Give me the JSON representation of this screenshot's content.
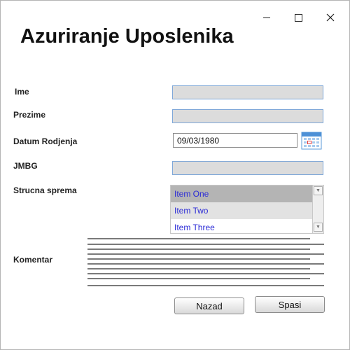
{
  "window": {
    "title": "Azuriranje Uposlenika",
    "controls": [
      "minimize-icon",
      "maximize-icon",
      "close-icon"
    ]
  },
  "form": {
    "ime_label": "Ime",
    "prezime_label": "Prezime",
    "datum_label": "Datum Rodjenja",
    "datum_value": "09/03/1980",
    "jmbg_label": "JMBG",
    "strucna_label": "Strucna sprema",
    "strucna_items": [
      "Item One",
      "Item Two",
      "Item Three"
    ],
    "selected_item": "Item One",
    "komentar_label": "Komentar"
  },
  "buttons": {
    "nazad": "Nazad",
    "spasi": "Spasi"
  },
  "colors": {
    "field_bg": "#dcdcdc",
    "field_border": "#7ea7d8",
    "list_selected": "#b4b4b4",
    "list_hover": "#e2e2e2",
    "list_text": "#2c2cd6"
  }
}
